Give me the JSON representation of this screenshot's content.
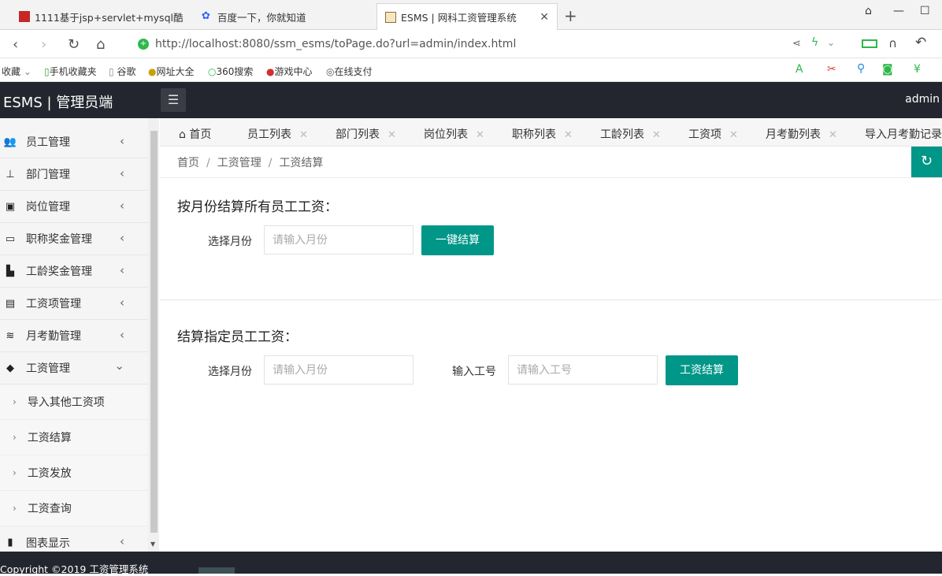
{
  "browser": {
    "tabs": [
      {
        "title": "1111基于jsp+servlet+mysql酷"
      },
      {
        "title": "百度一下，你就知道"
      },
      {
        "title": "ESMS | 网科工资管理系统"
      }
    ],
    "new_tab": "+",
    "url": "http://localhost:8080/ssm_esms/toPage.do?url=admin/index.html",
    "bookmarks": [
      "收藏",
      "手机收藏夹",
      "谷歌",
      "网址大全",
      "360搜索",
      "游戏中心",
      "在线支付"
    ]
  },
  "header": {
    "brand": "ESMS | 管理员端",
    "user": "admin"
  },
  "sidebar": {
    "items": [
      {
        "label": "员工管理",
        "icon": "users-icon"
      },
      {
        "label": "部门管理",
        "icon": "sitemap-icon"
      },
      {
        "label": "岗位管理",
        "icon": "id-card-icon"
      },
      {
        "label": "职称奖金管理",
        "icon": "briefcase-icon"
      },
      {
        "label": "工龄奖金管理",
        "icon": "building-icon"
      },
      {
        "label": "工资项管理",
        "icon": "monitor-icon"
      },
      {
        "label": "月考勤管理",
        "icon": "layers-icon"
      },
      {
        "label": "工资管理",
        "icon": "tag-icon"
      }
    ],
    "subitems": [
      {
        "label": "导入其他工资项"
      },
      {
        "label": "工资结算"
      },
      {
        "label": "工资发放"
      },
      {
        "label": "工资查询"
      }
    ],
    "last_item": {
      "label": "图表显示",
      "icon": "book-icon"
    }
  },
  "tabs": [
    {
      "label": "首页"
    },
    {
      "label": "员工列表"
    },
    {
      "label": "部门列表"
    },
    {
      "label": "岗位列表"
    },
    {
      "label": "职称列表"
    },
    {
      "label": "工龄列表"
    },
    {
      "label": "工资项"
    },
    {
      "label": "月考勤列表"
    },
    {
      "label": "导入月考勤记录"
    }
  ],
  "breadcrumb": [
    "首页",
    "工资管理",
    "工资结算"
  ],
  "section1": {
    "title": "按月份结算所有员工工资：",
    "month_label": "选择月份",
    "month_placeholder": "请输入月份",
    "button": "一键结算"
  },
  "section2": {
    "title": "结算指定员工工资：",
    "month_label": "选择月份",
    "month_placeholder": "请输入月份",
    "id_label": "输入工号",
    "id_placeholder": "请输入工号",
    "button": "工资结算"
  },
  "footer": {
    "copyright": "Copyright ©2019 工资管理系统"
  },
  "colors": {
    "accent": "#009688",
    "header_bg": "#23262e"
  }
}
